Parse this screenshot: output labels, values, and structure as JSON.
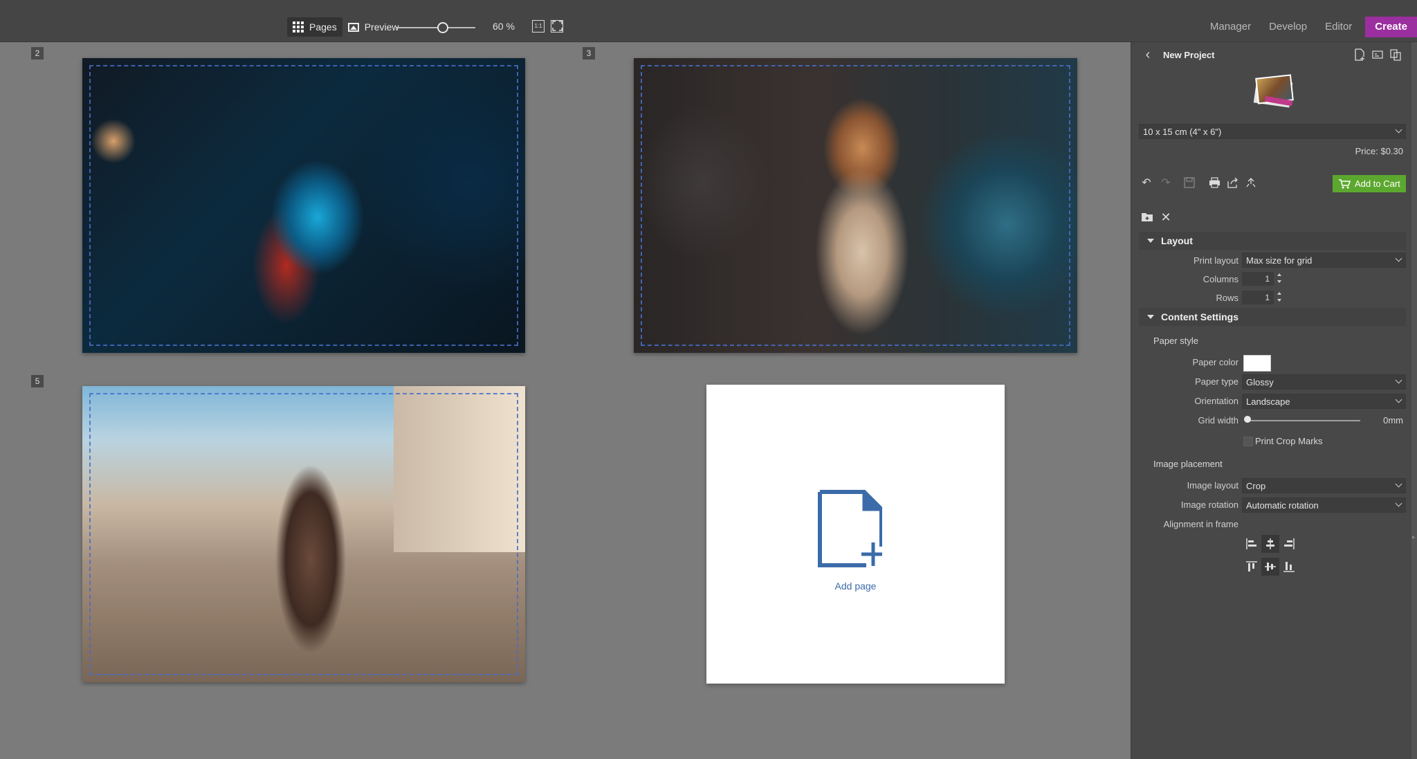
{
  "toolbar": {
    "pages_label": "Pages",
    "preview_label": "Preview",
    "zoom_label": "60 %",
    "zoom_value": 60,
    "actual_size_icon_text": "1:1",
    "modules": [
      "Manager",
      "Develop",
      "Editor",
      "Create"
    ],
    "active_module": "Create"
  },
  "canvas": {
    "page_numbers": [
      "2",
      "3",
      "5"
    ],
    "add_page_label": "Add page",
    "accent_color": "#3b6ba8"
  },
  "panel": {
    "back_label": "New Project",
    "size_select": "10 x 15 cm (4\" x 6\")",
    "price": "Price: $0.30",
    "add_to_cart": "Add to Cart",
    "layout": {
      "title": "Layout",
      "print_layout_label": "Print layout",
      "print_layout_value": "Max size for grid",
      "columns_label": "Columns",
      "columns_value": "1",
      "rows_label": "Rows",
      "rows_value": "1"
    },
    "content": {
      "title": "Content Settings",
      "paper_style_label": "Paper style",
      "paper_color_label": "Paper color",
      "paper_color_value": "#ffffff",
      "paper_type_label": "Paper type",
      "paper_type_value": "Glossy",
      "orientation_label": "Orientation",
      "orientation_value": "Landscape",
      "grid_width_label": "Grid width",
      "grid_width_value": "0mm",
      "print_crop_marks_label": "Print Crop Marks",
      "image_placement_label": "Image placement",
      "image_layout_label": "Image layout",
      "image_layout_value": "Crop",
      "image_rotation_label": "Image rotation",
      "image_rotation_value": "Automatic rotation",
      "alignment_label": "Alignment in frame"
    }
  },
  "colors": {
    "create_button": "#9b2f9f",
    "add_to_cart": "#5ca82f",
    "panel_bg": "#484848",
    "canvas_bg": "#7b7b7b"
  }
}
